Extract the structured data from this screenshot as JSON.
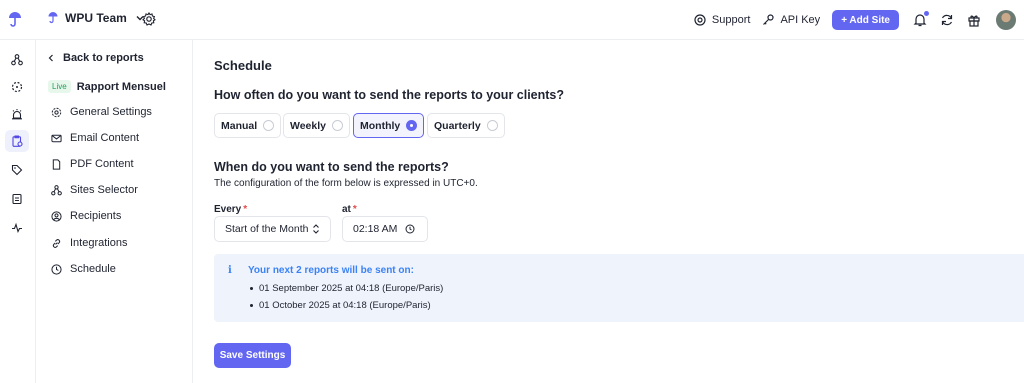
{
  "topbar": {
    "team_name": "WPU Team",
    "support_label": "Support",
    "api_key_label": "API Key",
    "add_site_label": "+ Add Site",
    "accent_color": "#6366f1"
  },
  "subnav": {
    "back_label": "Back to reports",
    "live_badge": "Live",
    "report_name": "Rapport Mensuel",
    "items": [
      {
        "label": "General Settings",
        "icon": "gear-icon"
      },
      {
        "label": "Email Content",
        "icon": "mail-icon"
      },
      {
        "label": "PDF Content",
        "icon": "file-icon"
      },
      {
        "label": "Sites Selector",
        "icon": "sites-icon"
      },
      {
        "label": "Recipients",
        "icon": "user-circle-icon"
      },
      {
        "label": "Integrations",
        "icon": "link-icon"
      },
      {
        "label": "Schedule",
        "icon": "clock-icon"
      }
    ]
  },
  "main": {
    "title": "Schedule",
    "frequency_question": "How often do you want to send the reports to your clients?",
    "frequency_options": [
      "Manual",
      "Weekly",
      "Monthly",
      "Quarterly"
    ],
    "frequency_selected": "Monthly",
    "when_question": "When do you want to send the reports?",
    "when_subtitle": "The configuration of the form below is expressed in UTC+0.",
    "every_label": "Every",
    "every_value": "Start of the Month",
    "at_label": "at",
    "time_value": "02:18 AM",
    "info_icon": "i",
    "info_heading": "Your next 2 reports will be sent on:",
    "schedule_dates": [
      "01 September 2025 at 04:18 (Europe/Paris)",
      "01 October 2025 at 04:18 (Europe/Paris)"
    ],
    "save_label": "Save Settings"
  }
}
